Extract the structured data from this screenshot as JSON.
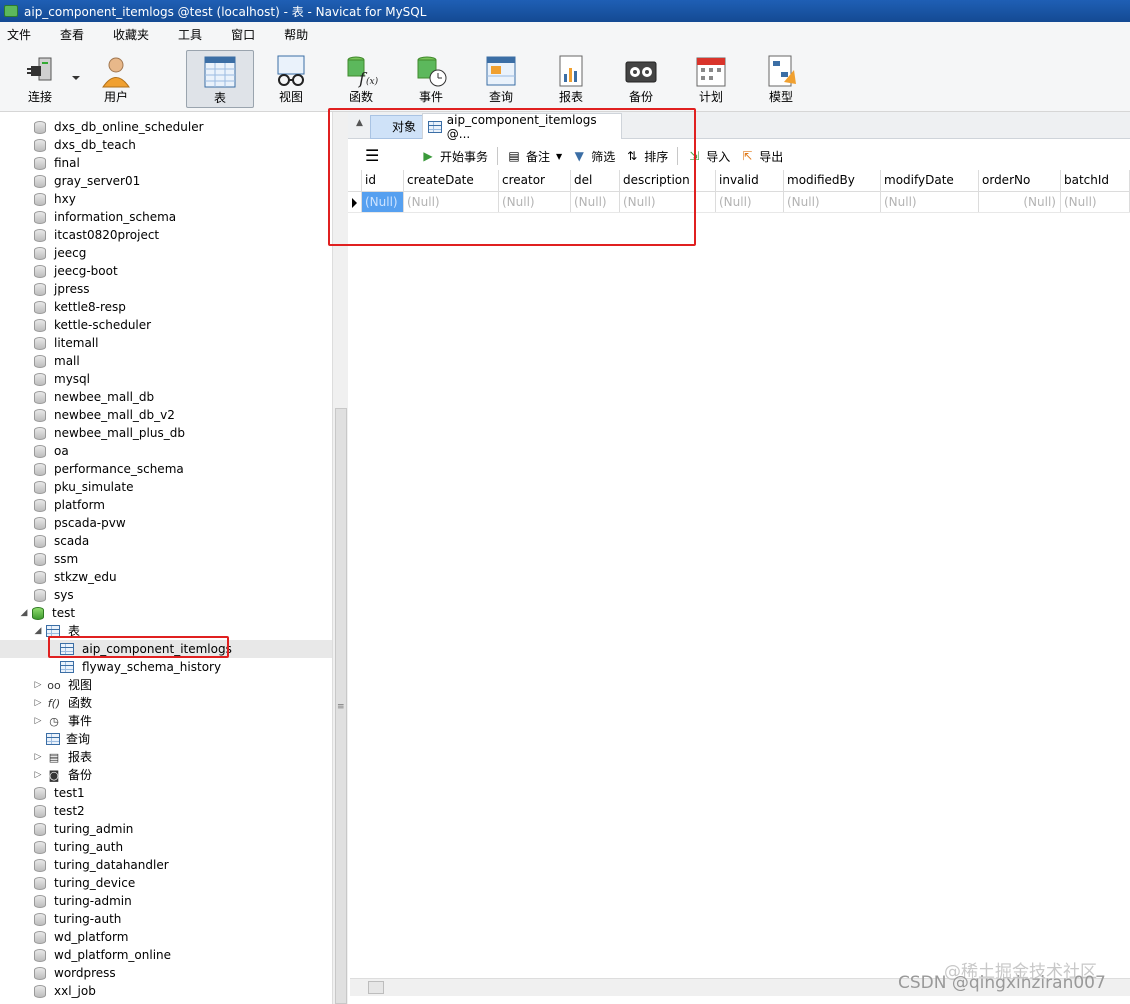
{
  "window": {
    "title": "aip_component_itemlogs @test (localhost) - 表 - Navicat for MySQL"
  },
  "menu": [
    "文件",
    "查看",
    "收藏夹",
    "工具",
    "窗口",
    "帮助"
  ],
  "toolbar": [
    {
      "label": "连接",
      "icon": "plug-icon"
    },
    {
      "label": "用户",
      "icon": "user-icon"
    },
    {
      "label": "表",
      "icon": "table-icon",
      "active": true
    },
    {
      "label": "视图",
      "icon": "glasses-icon"
    },
    {
      "label": "函数",
      "icon": "function-icon"
    },
    {
      "label": "事件",
      "icon": "event-icon"
    },
    {
      "label": "查询",
      "icon": "query-icon"
    },
    {
      "label": "报表",
      "icon": "report-icon"
    },
    {
      "label": "备份",
      "icon": "backup-icon"
    },
    {
      "label": "计划",
      "icon": "calendar-icon"
    },
    {
      "label": "模型",
      "icon": "model-icon"
    }
  ],
  "sidebar": {
    "databases_before": [
      "dxs_db_online_scheduler",
      "dxs_db_teach",
      "final",
      "gray_server01",
      "hxy",
      "information_schema",
      "itcast0820project",
      "jeecg",
      "jeecg-boot",
      "jpress",
      "kettle8-resp",
      "kettle-scheduler",
      "litemall",
      "mall",
      "mysql",
      "newbee_mall_db",
      "newbee_mall_db_v2",
      "newbee_mall_plus_db",
      "oa",
      "performance_schema",
      "pku_simulate",
      "platform",
      "pscada-pvw",
      "scada",
      "ssm",
      "stkzw_edu",
      "sys"
    ],
    "open_db": "test",
    "tables_folder": "表",
    "tables": [
      "aip_component_itemlogs",
      "flyway_schema_history"
    ],
    "folders": [
      "视图",
      "函数",
      "事件",
      "查询",
      "报表",
      "备份"
    ],
    "databases_after": [
      "test1",
      "test2",
      "turing_admin",
      "turing_auth",
      "turing_datahandler",
      "turing_device",
      "turing-admin",
      "turing-auth",
      "wd_platform",
      "wd_platform_online",
      "wordpress",
      "xxl_job"
    ]
  },
  "tabs": {
    "objects": "对象",
    "table_tab": "aip_component_itemlogs @..."
  },
  "grid_toolbar": {
    "begin_transaction": "开始事务",
    "memo": "备注",
    "filter": "筛选",
    "sort": "排序",
    "import": "导入",
    "export": "导出"
  },
  "columns": [
    "id",
    "createDate",
    "creator",
    "del",
    "description",
    "invalid",
    "modifiedBy",
    "modifyDate",
    "orderNo",
    "batchId"
  ],
  "row": [
    "(Null)",
    "(Null)",
    "(Null)",
    "(Null)",
    "(Null)",
    "(Null)",
    "(Null)",
    "(Null)",
    "(Null)",
    "(Null)"
  ],
  "watermark": {
    "line1": "@稀土掘金技术社区",
    "line2": "CSDN @qingxinziran007"
  }
}
